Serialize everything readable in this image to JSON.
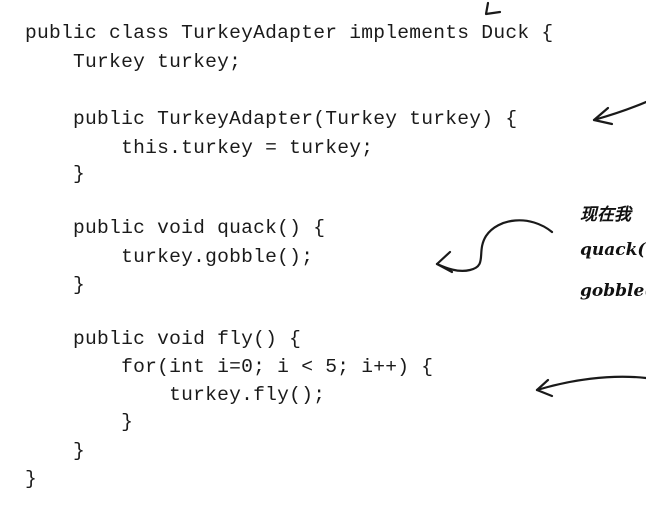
{
  "code": {
    "lines": [
      "public class TurkeyAdapter implements Duck {",
      "    Turkey turkey;",
      "",
      "    public TurkeyAdapter(Turkey turkey) {",
      "        this.turkey = turkey;",
      "    }",
      "",
      "    public void quack() {",
      "        turkey.gobble();",
      "    }",
      "",
      "    public void fly() {",
      "        for(int i=0; i < 5; i++) {",
      "            turkey.fly();",
      "        }",
      "    }",
      "}"
    ]
  },
  "annotations": {
    "note_line1": "现在我",
    "note_line2": "quack(",
    "note_line3": "gobble("
  }
}
